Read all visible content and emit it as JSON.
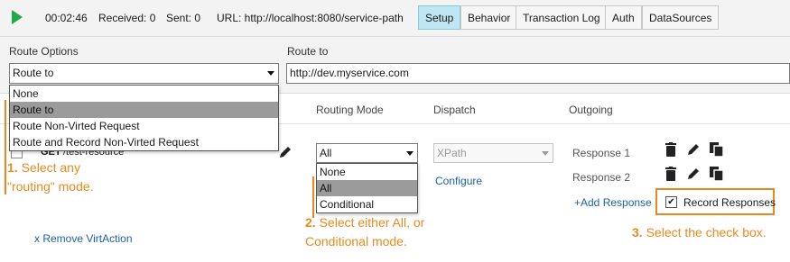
{
  "topbar": {
    "timer": "00:02:46",
    "received": "Received: 0",
    "sent": "Sent: 0",
    "url": "URL: http://localhost:8080/service-path",
    "tabs": [
      "Setup",
      "Behavior",
      "Transaction Log",
      "Auth",
      "DataSources"
    ],
    "active_tab": "Setup"
  },
  "route": {
    "options_label": "Route Options",
    "selected": "Route to",
    "options": [
      "None",
      "Route to",
      "Route Non-Virted Request",
      "Route and Record Non-Virted Request"
    ],
    "to_label": "Route to",
    "to_value": "http://dev.myservice.com"
  },
  "table": {
    "headers": {
      "routing_mode": "Routing Mode",
      "dispatch": "Dispatch",
      "outgoing": "Outgoing"
    },
    "row": {
      "method": "GET",
      "path": "/test-resource"
    },
    "routing_mode_selected": "All",
    "routing_mode_options": [
      "None",
      "All",
      "Conditional"
    ],
    "dispatch_value": "XPath",
    "configure": "Configure",
    "responses": [
      "Response 1",
      "Response 2"
    ],
    "add_response": "+Add Response",
    "record_responses": "Record Responses",
    "remove": "x Remove VirtAction"
  },
  "callouts": {
    "c1_num": "1.",
    "c1_line1": "Select any",
    "c1_line2": "\"routing\" mode.",
    "c2_num": "2.",
    "c2_line1": "Select either All, or",
    "c2_line2": "Conditional mode.",
    "c3_num": "3.",
    "c3_text": "Select the check box."
  },
  "colors": {
    "accent_orange": "#e8891d",
    "play_green": "#1fa84c",
    "tab_active": "#bfe6f3",
    "link_blue": "#1a62a8"
  },
  "icons": [
    "play-icon",
    "edit-icon",
    "trash-icon",
    "copy-icon",
    "checkbox-icon"
  ]
}
